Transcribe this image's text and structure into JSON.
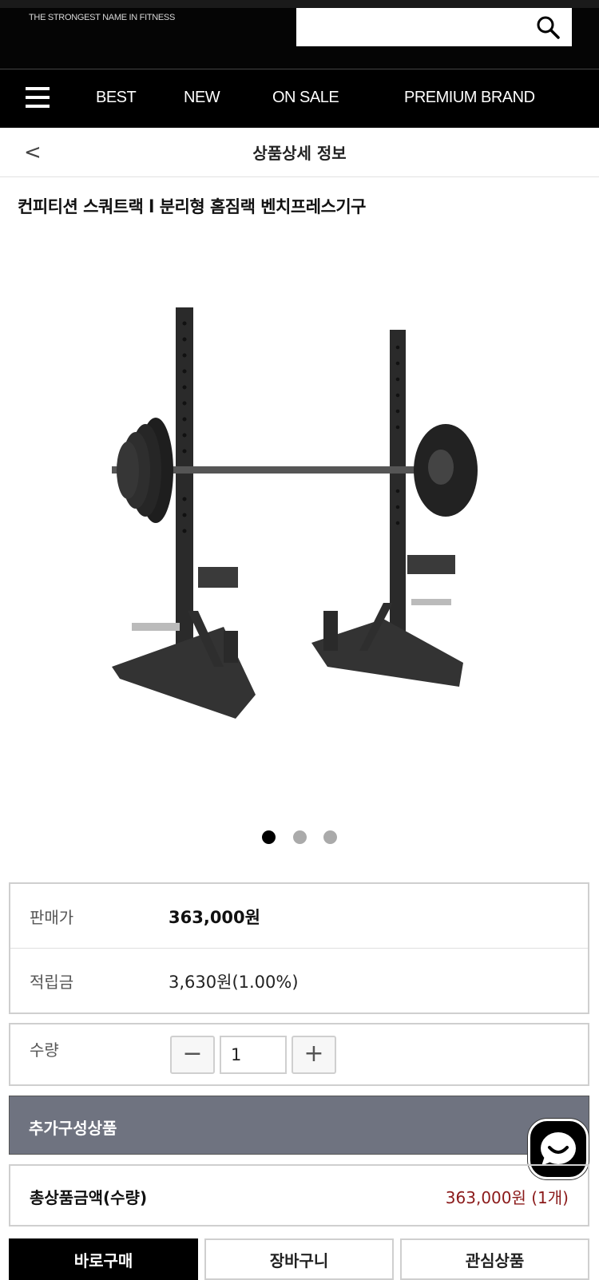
{
  "header": {
    "tagline": "THE STRONGEST NAME IN FITNESS",
    "search": {
      "value": "",
      "placeholder": ""
    }
  },
  "nav": {
    "menu_icon": "hamburger-icon",
    "items": [
      {
        "label": "BEST"
      },
      {
        "label": "NEW"
      },
      {
        "label": "ON SALE"
      },
      {
        "label": "PREMIUM BRAND"
      }
    ]
  },
  "subheader": {
    "back_glyph": "<",
    "title": "상품상세 정보"
  },
  "product": {
    "title": "컨피티션 스쿼트랙 l 분리형 홈짐랙 벤치프레스기구",
    "carousel": {
      "count": 3,
      "active": 0
    }
  },
  "price": {
    "sale_label": "판매가",
    "sale_value": "363,000원",
    "points_label": "적립금",
    "points_value": "3,630원(1.00%)"
  },
  "quantity": {
    "label": "수량",
    "minus": "−",
    "value": "1",
    "plus": "+"
  },
  "addon": {
    "label": "추가구성상품"
  },
  "total": {
    "label": "총상품금액(수량)",
    "value": "363,000원 (1개)"
  },
  "actions": {
    "buy": "바로구매",
    "cart": "장바구니",
    "wish": "관심상품"
  },
  "colors": {
    "header_bg": "#000000",
    "addon_bg": "#6f7380",
    "total_price": "#8b1a1a"
  }
}
